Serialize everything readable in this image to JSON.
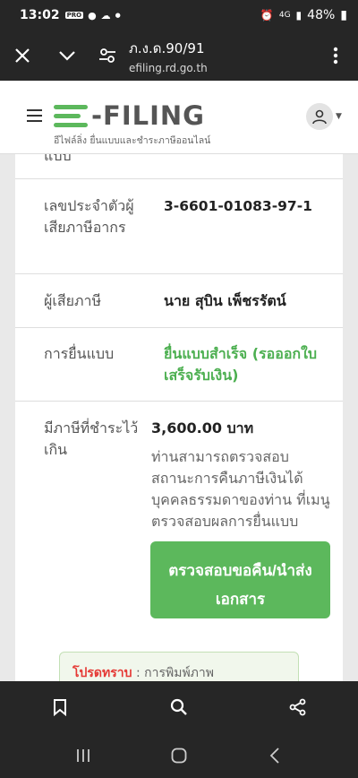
{
  "status_bar": {
    "time": "13:02",
    "battery": "48%",
    "network": "4G"
  },
  "browser": {
    "page_title": "ภ.ง.ด.90/91",
    "domain": "efiling.rd.go.th"
  },
  "site_header": {
    "logo_text": "-FILING",
    "logo_subtitle": "อีไฟล์ลิ่ง ยื่นแบบและชำระภาษีออนไลน์"
  },
  "details": {
    "partial_label": "แบบ",
    "tax_id_label": "เลขประจำตัวผู้เสียภาษีอากร",
    "tax_id_value": "3-6601-01083-97-1",
    "taxpayer_label": "ผู้เสียภาษี",
    "taxpayer_value": "นาย สุบิน เพ็ชรรัตน์",
    "filing_label": "การยื่นแบบ",
    "filing_value": "ยื่นแบบสำเร็จ (รอออกใบเสร็จรับเงิน)",
    "refund_label": "มีภาษีที่ชำระไว้เกิน",
    "refund_amount": "3,600.00 บาท",
    "refund_note": "ท่านสามารถตรวจสอบสถานะการคืนภาษีเงินได้บุคคลธรรมดาของท่าน ที่เมนูตรวจสอบผลการยื่นแบบ",
    "action_button": "ตรวจสอบขอคืน/นำส่งเอกสาร"
  },
  "alert": {
    "warning_word": "โปรดทราบ",
    "rest_text": " : การพิมพ์ภาพ"
  },
  "colors": {
    "accent_green": "#5cb85c",
    "warning_red": "#e53935",
    "dark_bar": "#262626"
  },
  "icons": {
    "close": "close-icon",
    "expand": "chevron-down-icon",
    "site_settings": "tune-icon",
    "menu": "more-vert-icon",
    "bookmark": "bookmark-icon",
    "search": "search-icon",
    "share": "share-icon"
  }
}
